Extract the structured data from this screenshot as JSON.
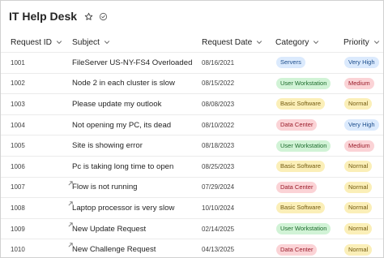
{
  "app": {
    "title": "IT Help Desk"
  },
  "header_icons": {
    "favorite": "star-outline-icon",
    "status": "check-circle-icon"
  },
  "columns": [
    {
      "key": "id",
      "label": "Request ID"
    },
    {
      "key": "subject",
      "label": "Subject"
    },
    {
      "key": "date",
      "label": "Request Date"
    },
    {
      "key": "category",
      "label": "Category"
    },
    {
      "key": "priority",
      "label": "Priority"
    }
  ],
  "category_colors": {
    "Servers": {
      "bg": "#dbeafd",
      "fg": "#1e4e8c"
    },
    "User Workstation": {
      "bg": "#d1f3d6",
      "fg": "#1d6b2c"
    },
    "Basic Software": {
      "bg": "#fbefb8",
      "fg": "#735a0f"
    },
    "Data Center": {
      "bg": "#fbd3d6",
      "fg": "#9a1c2a"
    }
  },
  "priority_colors": {
    "Very High": {
      "bg": "#dbeafd",
      "fg": "#1e4e8c"
    },
    "Medium": {
      "bg": "#fbd3d6",
      "fg": "#9a1c2a"
    },
    "Normal": {
      "bg": "#fbefb8",
      "fg": "#735a0f"
    }
  },
  "rows": [
    {
      "id": "1001",
      "subject": "FileServer US-NY-FS4 Overloaded",
      "date": "08/16/2021",
      "category": "Servers",
      "priority": "Very High",
      "new": false
    },
    {
      "id": "1002",
      "subject": "Node 2 in each cluster is slow",
      "date": "08/15/2022",
      "category": "User Workstation",
      "priority": "Medium",
      "new": false
    },
    {
      "id": "1003",
      "subject": "Please update my outlook",
      "date": "08/08/2023",
      "category": "Basic Software",
      "priority": "Normal",
      "new": false
    },
    {
      "id": "1004",
      "subject": "Not opening my PC, its dead",
      "date": "08/10/2022",
      "category": "Data Center",
      "priority": "Very High",
      "new": false
    },
    {
      "id": "1005",
      "subject": "Site is showing error",
      "date": "08/18/2023",
      "category": "User Workstation",
      "priority": "Medium",
      "new": false
    },
    {
      "id": "1006",
      "subject": "Pc is taking long time to open",
      "date": "08/25/2023",
      "category": "Basic Software",
      "priority": "Normal",
      "new": false
    },
    {
      "id": "1007",
      "subject": "Flow is not running",
      "date": "07/29/2024",
      "category": "Data Center",
      "priority": "Normal",
      "new": true
    },
    {
      "id": "1008",
      "subject": "Laptop processor is very slow",
      "date": "10/10/2024",
      "category": "Basic Software",
      "priority": "Normal",
      "new": true
    },
    {
      "id": "1009",
      "subject": "New Update Request",
      "date": "02/14/2025",
      "category": "User Workstation",
      "priority": "Normal",
      "new": true
    },
    {
      "id": "1010",
      "subject": "New Challenge Request",
      "date": "04/13/2025",
      "category": "Data Center",
      "priority": "Normal",
      "new": true
    }
  ]
}
